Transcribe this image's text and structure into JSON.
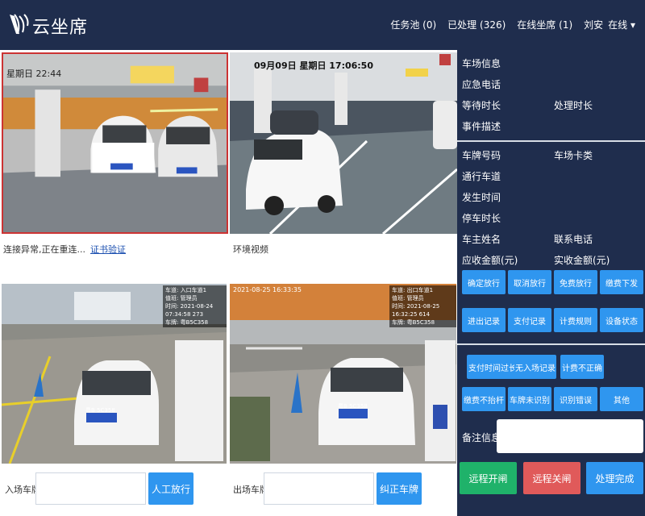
{
  "header": {
    "logo_text": "云坐席",
    "nav": [
      {
        "label": "任务池",
        "count": "(0)"
      },
      {
        "label": "已处理",
        "count": "(326)"
      },
      {
        "label": "在线坐席",
        "count": "(1)"
      }
    ],
    "user": "刘安",
    "status": "在线 ▾"
  },
  "cameras": {
    "cam1_overlay": "星期日 22:44",
    "cam1_label": "连接异常,正在重连...",
    "cam1_link": "证书验证",
    "cam2_overlay": "09月09日 星期日 17:06:50",
    "cam2_label": "环境视频",
    "cam3_overlay": [
      "车道: 入口车道1",
      "值班: 管理员",
      "时间: 2021-08-24 07:34:58 273",
      "车牌: 粤B5C358"
    ],
    "cam4_overlay": [
      "车道: 出口车道1",
      "值班: 管理员",
      "时间: 2021-08-25 16:32:25 614",
      "车牌: 粤B5C358"
    ],
    "cam4_ts": "2021-08-25 16:33:35",
    "plate_text": "粤B 5C358"
  },
  "entry": {
    "label": "入场车牌",
    "value": "",
    "button": "人工放行"
  },
  "exit": {
    "label": "出场车牌",
    "value": "",
    "button": "纠正车牌"
  },
  "info": {
    "park_info": "车场信息",
    "emergency": "应急电话",
    "wait_time": "等待时长",
    "handle_time": "处理时长",
    "event_desc": "事件描述",
    "plate_no": "车牌号码",
    "card_type": "车场卡类",
    "lane": "通行车道",
    "occur_time": "发生时间",
    "park_time": "停车时长",
    "owner": "车主姓名",
    "phone": "联系电话",
    "due": "应收金额(元)",
    "paid": "实收金额(元)"
  },
  "actions_row1": [
    "确定放行",
    "取消放行",
    "免费放行",
    "缴费下发"
  ],
  "actions_row2": [
    "进出记录",
    "支付记录",
    "计费规则",
    "设备状态"
  ],
  "reasons_row1": [
    "支付时间过长",
    "无入场记录",
    "计费不正确"
  ],
  "reasons_row2": [
    "缴费不抬杆",
    "车牌未识别",
    "识别错误",
    "其他"
  ],
  "remark_label": "备注信息",
  "bottom_buttons": {
    "open": "远程开闸",
    "close": "远程关闸",
    "done": "处理完成"
  },
  "colors": {
    "open": "#1fb26a",
    "close": "#e05a5a",
    "done": "#2f96ef"
  }
}
